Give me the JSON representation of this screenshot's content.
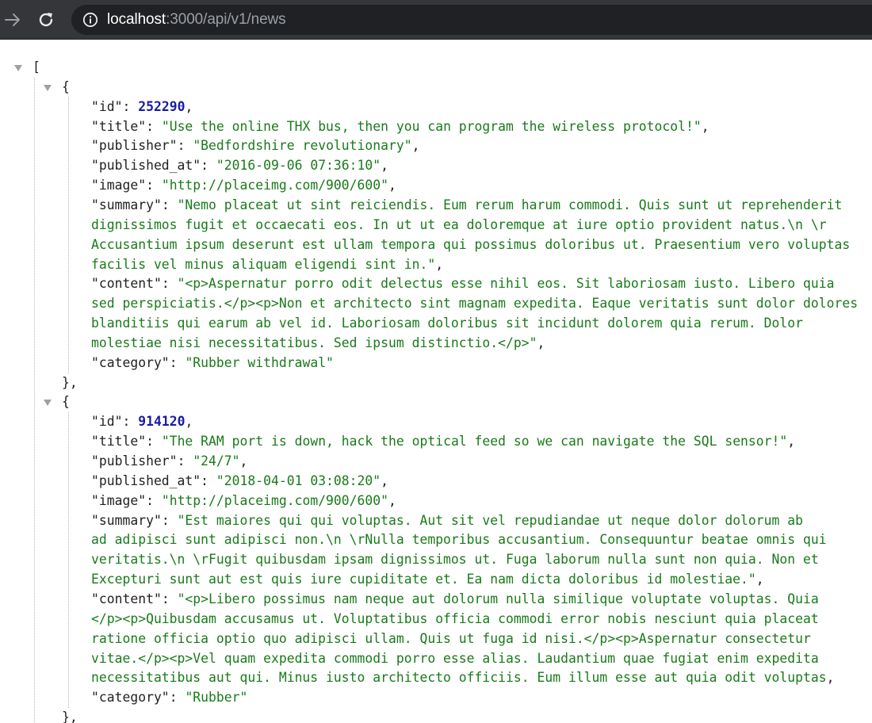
{
  "browser": {
    "url_host": "localhost",
    "url_path": ":3000/api/v1/news"
  },
  "json": {
    "items": [
      {
        "fields": [
          {
            "key": "\"id\"",
            "value": "252290",
            "type": "num",
            "trail": ","
          },
          {
            "key": "\"title\"",
            "value": "\"Use the online THX bus, then you can program the wireless protocol!\"",
            "type": "str",
            "trail": ","
          },
          {
            "key": "\"publisher\"",
            "value": "\"Bedfordshire revolutionary\"",
            "type": "str",
            "trail": ","
          },
          {
            "key": "\"published_at\"",
            "value": "\"2016-09-06 07:36:10\"",
            "type": "str",
            "trail": ","
          },
          {
            "key": "\"image\"",
            "value": "\"http://placeimg.com/900/600\"",
            "type": "str",
            "trail": ","
          },
          {
            "key": "\"summary\"",
            "value_lines": [
              "\"Nemo placeat ut sint reiciendis. Eum rerum harum commodi. Quis sunt ut reprehenderit",
              "dignissimos fugit et occaecati eos. In ut ut ea doloremque at iure optio provident natus.\\n \\r",
              "Accusantium ipsum deserunt est ullam tempora qui possimus doloribus ut. Praesentium vero voluptas",
              "facilis vel minus aliquam eligendi sint in.\""
            ],
            "type": "str",
            "trail": ","
          },
          {
            "key": "\"content\"",
            "value_lines": [
              "\"<p>Aspernatur porro odit delectus esse nihil eos. Sit laboriosam iusto. Libero quia",
              "sed perspiciatis.</p><p>Non et architecto sint magnam expedita. Eaque veritatis sunt dolor dolores",
              "blanditiis qui earum ab vel id. Laboriosam doloribus sit incidunt dolorem quia rerum. Dolor",
              "molestiae nisi necessitatibus. Sed ipsum distinctio.</p>\""
            ],
            "type": "str",
            "trail": ","
          },
          {
            "key": "\"category\"",
            "value": "\"Rubber withdrawal\"",
            "type": "str",
            "trail": ""
          }
        ]
      },
      {
        "fields": [
          {
            "key": "\"id\"",
            "value": "914120",
            "type": "num",
            "trail": ","
          },
          {
            "key": "\"title\"",
            "value": "\"The RAM port is down, hack the optical feed so we can navigate the SQL sensor!\"",
            "type": "str",
            "trail": ","
          },
          {
            "key": "\"publisher\"",
            "value": "\"24/7\"",
            "type": "str",
            "trail": ","
          },
          {
            "key": "\"published_at\"",
            "value": "\"2018-04-01 03:08:20\"",
            "type": "str",
            "trail": ","
          },
          {
            "key": "\"image\"",
            "value": "\"http://placeimg.com/900/600\"",
            "type": "str",
            "trail": ","
          },
          {
            "key": "\"summary\"",
            "value_lines": [
              "\"Est maiores qui qui voluptas. Aut sit vel repudiandae ut neque dolor dolorum ab",
              "ad adipisci sunt adipisci non.\\n \\rNulla temporibus accusantium. Consequuntur beatae omnis qui",
              "veritatis.\\n \\rFugit quibusdam ipsam dignissimos ut. Fuga laborum nulla sunt non quia. Non et",
              "Excepturi sunt aut est quis iure cupiditate et. Ea nam dicta doloribus id molestiae.\""
            ],
            "type": "str",
            "trail": ","
          },
          {
            "key": "\"content\"",
            "value_lines": [
              "\"<p>Libero possimus nam neque aut dolorum nulla similique voluptate voluptas. Quia",
              "</p><p>Quibusdam accusamus ut. Voluptatibus officia commodi error nobis nesciunt quia placeat",
              "ratione officia optio quo adipisci ullam. Quis ut fuga id nisi.</p><p>Aspernatur consectetur",
              "vitae.</p><p>Vel quam expedita commodi porro esse alias. Laudantium quae fugiat enim expedita",
              "necessitatibus aut qui. Minus iusto architecto officiis. Eum illum esse aut quia odit voluptas"
            ],
            "type": "str",
            "trail": ","
          },
          {
            "key": "\"category\"",
            "value": "\"Rubber\"",
            "type": "str",
            "trail": ""
          }
        ]
      }
    ]
  },
  "icons": {
    "forward": "arrow-forward-icon",
    "reload": "reload-icon",
    "info": "site-info-icon",
    "toggle": "collapse-triangle-icon"
  }
}
